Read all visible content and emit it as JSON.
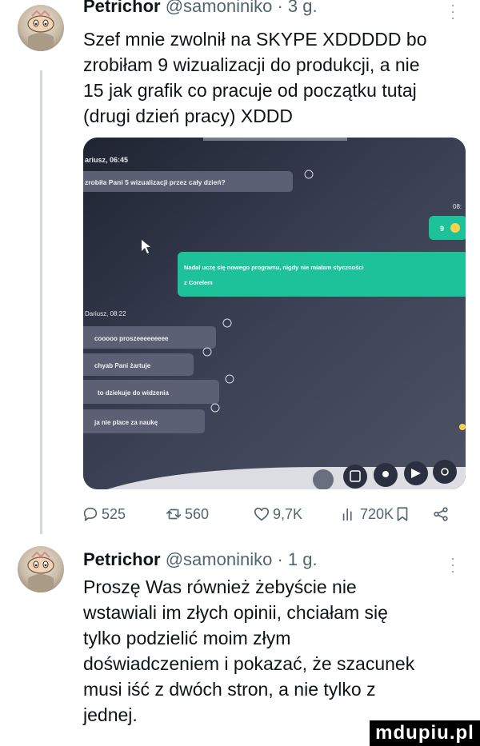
{
  "tweets": [
    {
      "author_name": "Petrichor",
      "meta": "@samoniniko · 3 g.",
      "text_lines": [
        "Szef mnie zwolnił na SKYPE XDDDDD bo",
        "zrobiłam 9 wizualizacji do produkcji, a nie",
        "15 jak grafik co pracuje od początku tutaj",
        "(drugi dzień pracy) XDDD"
      ],
      "media": {
        "top_sender": "ariusz, 06:45",
        "msg1": "zrobiła Pani 5 wizualizacji przez cały dzień?",
        "time_right": "08:",
        "count_badge": "9",
        "reply_line1": "Nadal uczę się nowego programu, nigdy nie miałam styczności",
        "reply_line2": "z Corelem",
        "second_sender": "Dariusz, 08:22",
        "msgs": [
          "cooooo proszeeeeeeeee",
          "chyab Pani żartuje",
          "to dziekuje do widzenia",
          "ja nie place za naukę"
        ]
      },
      "actions": {
        "replies": "525",
        "retweets": "560",
        "likes": "9,7K",
        "views": "720K"
      }
    },
    {
      "author_name": "Petrichor",
      "meta": "@samoniniko · 1 g.",
      "text_lines": [
        "Proszę Was również żebyście nie",
        "wstawiali im złych opinii, chciałam się",
        "tylko podzielić moim złym",
        "doświadczeniem i pokazać, że szacunek",
        "musi iść z dwóch stron, a nie tylko z",
        "jednej."
      ]
    }
  ],
  "watermark": "mdupiu.pl",
  "colors": {
    "text": "#0f1419",
    "muted": "#536471",
    "thread_line": "#cfd9de",
    "reply_bubble": "#1ec29a"
  },
  "icons": [
    "reply-icon",
    "retweet-icon",
    "like-icon",
    "views-icon",
    "bookmark-icon",
    "share-icon",
    "more-icon"
  ]
}
